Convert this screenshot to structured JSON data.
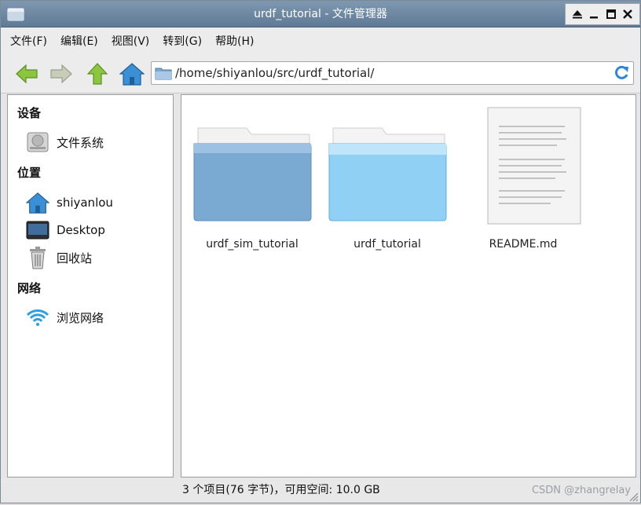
{
  "window": {
    "title": "urdf_tutorial - 文件管理器"
  },
  "menu": {
    "items": [
      {
        "label": "文件(F)"
      },
      {
        "label": "编辑(E)"
      },
      {
        "label": "视图(V)"
      },
      {
        "label": "转到(G)"
      },
      {
        "label": "帮助(H)"
      }
    ]
  },
  "toolbar": {
    "path": "/home/shiyanlou/src/urdf_tutorial/",
    "icons": [
      "back-arrow-icon",
      "forward-arrow-icon",
      "up-arrow-icon",
      "home-icon",
      "folder-icon",
      "refresh-icon"
    ]
  },
  "sidebar": {
    "sections": [
      {
        "header": "设备",
        "items": [
          {
            "label": "文件系统",
            "icon": "drive-icon"
          }
        ]
      },
      {
        "header": "位置",
        "items": [
          {
            "label": "shiyanlou",
            "icon": "home-icon"
          },
          {
            "label": "Desktop",
            "icon": "desktop-icon"
          },
          {
            "label": "回收站",
            "icon": "trash-icon"
          }
        ]
      },
      {
        "header": "网络",
        "items": [
          {
            "label": "浏览网络",
            "icon": "network-icon"
          }
        ]
      }
    ]
  },
  "files": [
    {
      "name": "urdf_sim_tutorial",
      "type": "folder"
    },
    {
      "name": "urdf_tutorial",
      "type": "folder"
    },
    {
      "name": "README.md",
      "type": "document"
    }
  ],
  "status": {
    "text": "3 个项目(76 字节)，可用空间: 10.0 GB",
    "watermark": "CSDN @zhangrelay"
  },
  "colors": {
    "titlebar": "#6f8aa5",
    "accent_blue": "#3b8fd4",
    "arrow_green": "#8cc63f"
  }
}
